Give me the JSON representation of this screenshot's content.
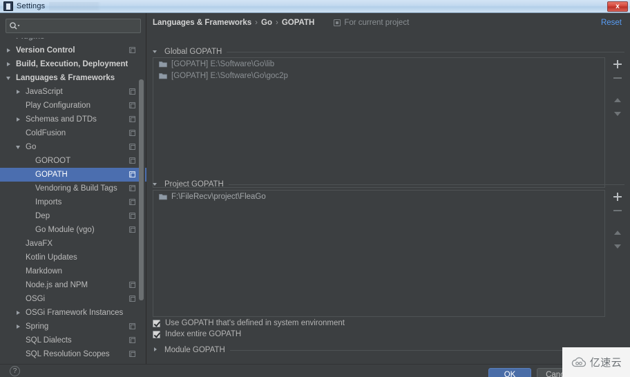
{
  "window": {
    "title": "Settings",
    "close_label": "x",
    "app_icon": "settings-window-icon"
  },
  "sidebar": {
    "search": {
      "value": "",
      "placeholder": "",
      "icon": "search-icon"
    },
    "tree": [
      {
        "label": "Plugins",
        "indent": 0,
        "arrow": "none",
        "bold": true,
        "copy": false,
        "selected": false,
        "clipped": true
      },
      {
        "label": "Version Control",
        "indent": 0,
        "arrow": "closed",
        "bold": true,
        "copy": true,
        "selected": false
      },
      {
        "label": "Build, Execution, Deployment",
        "indent": 0,
        "arrow": "closed",
        "bold": true,
        "copy": false,
        "selected": false
      },
      {
        "label": "Languages & Frameworks",
        "indent": 0,
        "arrow": "open",
        "bold": true,
        "copy": false,
        "selected": false
      },
      {
        "label": "JavaScript",
        "indent": 1,
        "arrow": "closed",
        "bold": false,
        "copy": true,
        "selected": false
      },
      {
        "label": "Play Configuration",
        "indent": 1,
        "arrow": "none",
        "bold": false,
        "copy": true,
        "selected": false
      },
      {
        "label": "Schemas and DTDs",
        "indent": 1,
        "arrow": "closed",
        "bold": false,
        "copy": true,
        "selected": false
      },
      {
        "label": "ColdFusion",
        "indent": 1,
        "arrow": "none",
        "bold": false,
        "copy": true,
        "selected": false
      },
      {
        "label": "Go",
        "indent": 1,
        "arrow": "open",
        "bold": false,
        "copy": true,
        "selected": false
      },
      {
        "label": "GOROOT",
        "indent": 2,
        "arrow": "none",
        "bold": false,
        "copy": true,
        "selected": false
      },
      {
        "label": "GOPATH",
        "indent": 2,
        "arrow": "none",
        "bold": false,
        "copy": true,
        "selected": true
      },
      {
        "label": "Vendoring & Build Tags",
        "indent": 2,
        "arrow": "none",
        "bold": false,
        "copy": true,
        "selected": false
      },
      {
        "label": "Imports",
        "indent": 2,
        "arrow": "none",
        "bold": false,
        "copy": true,
        "selected": false
      },
      {
        "label": "Dep",
        "indent": 2,
        "arrow": "none",
        "bold": false,
        "copy": true,
        "selected": false
      },
      {
        "label": "Go Module (vgo)",
        "indent": 2,
        "arrow": "none",
        "bold": false,
        "copy": true,
        "selected": false
      },
      {
        "label": "JavaFX",
        "indent": 1,
        "arrow": "none",
        "bold": false,
        "copy": false,
        "selected": false
      },
      {
        "label": "Kotlin Updates",
        "indent": 1,
        "arrow": "none",
        "bold": false,
        "copy": false,
        "selected": false
      },
      {
        "label": "Markdown",
        "indent": 1,
        "arrow": "none",
        "bold": false,
        "copy": false,
        "selected": false
      },
      {
        "label": "Node.js and NPM",
        "indent": 1,
        "arrow": "none",
        "bold": false,
        "copy": true,
        "selected": false
      },
      {
        "label": "OSGi",
        "indent": 1,
        "arrow": "none",
        "bold": false,
        "copy": true,
        "selected": false
      },
      {
        "label": "OSGi Framework Instances",
        "indent": 1,
        "arrow": "closed",
        "bold": false,
        "copy": false,
        "selected": false
      },
      {
        "label": "Spring",
        "indent": 1,
        "arrow": "closed",
        "bold": false,
        "copy": true,
        "selected": false
      },
      {
        "label": "SQL Dialects",
        "indent": 1,
        "arrow": "none",
        "bold": false,
        "copy": true,
        "selected": false
      },
      {
        "label": "SQL Resolution Scopes",
        "indent": 1,
        "arrow": "none",
        "bold": false,
        "copy": true,
        "selected": false
      }
    ]
  },
  "content": {
    "breadcrumb": {
      "items": [
        "Languages & Frameworks",
        "Go",
        "GOPATH"
      ],
      "separator": "›"
    },
    "scope": {
      "label": "For current project",
      "icon": "project-scope-icon"
    },
    "reset_label": "Reset",
    "global_gopath": {
      "title": "Global GOPATH",
      "expanded": true,
      "entries": [
        {
          "text": "[GOPATH] E:\\Software\\Go\\lib",
          "icon": "folder-icon"
        },
        {
          "text": "[GOPATH] E:\\Software\\Go\\goc2p",
          "icon": "folder-icon"
        }
      ],
      "toolbar": [
        {
          "name": "add-global-gopath-button",
          "icon": "plus-icon",
          "enabled": true
        },
        {
          "name": "remove-global-gopath-button",
          "icon": "minus-icon",
          "enabled": false
        },
        {
          "name": "move-up-global-gopath-button",
          "icon": "up-icon",
          "enabled": false
        },
        {
          "name": "move-down-global-gopath-button",
          "icon": "down-icon",
          "enabled": false
        }
      ]
    },
    "project_gopath": {
      "title": "Project GOPATH",
      "expanded": true,
      "entries": [
        {
          "text": "F:\\FileRecv\\project\\FleaGo",
          "icon": "folder-icon"
        }
      ],
      "toolbar": [
        {
          "name": "add-project-gopath-button",
          "icon": "plus-icon",
          "enabled": true
        },
        {
          "name": "remove-project-gopath-button",
          "icon": "minus-icon",
          "enabled": false
        },
        {
          "name": "move-up-project-gopath-button",
          "icon": "up-icon",
          "enabled": false
        },
        {
          "name": "move-down-project-gopath-button",
          "icon": "down-icon",
          "enabled": false
        }
      ]
    },
    "checkboxes": [
      {
        "label": "Use GOPATH that's defined in system environment",
        "checked": true
      },
      {
        "label": "Index entire GOPATH",
        "checked": true
      }
    ],
    "module_gopath": {
      "title": "Module GOPATH",
      "expanded": false
    }
  },
  "footer": {
    "help_icon": "?",
    "ok_label": "OK",
    "cancel_label": "Cancel"
  },
  "watermark": {
    "text": "亿速云",
    "icon": "cloud-icon"
  },
  "colors": {
    "background": "#3c3f41",
    "selection": "#4b6eaf",
    "link": "#589df6",
    "text": "#bbbbbb",
    "folder": "#8f9aa6",
    "titlebar": "#c2d9ef",
    "close": "#d3453a",
    "ok_button": "#4a6da7"
  }
}
